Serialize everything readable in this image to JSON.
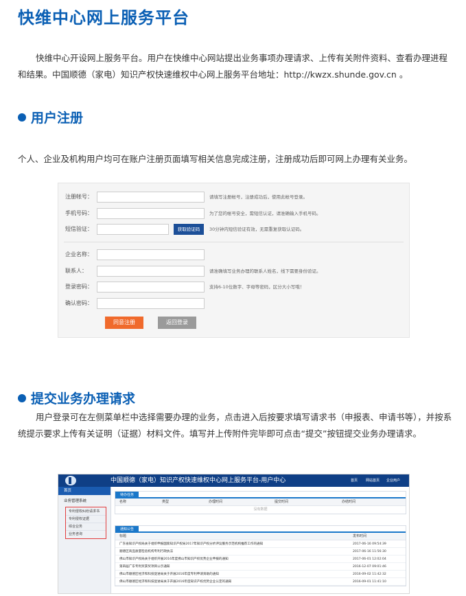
{
  "page": {
    "title": "快维中心网上服务平台",
    "intro": "快维中心开设网上服务平台。用户在快维中心网站提出业务事项办理请求、上传有关附件资料、查看办理进程和结果。中国顺德（家电）知识产权快速维权中心网上服务平台地址：http://kwzx.shunde.gov.cn 。"
  },
  "section1": {
    "title": "用户注册",
    "text": "个人、企业及机构用户均可在账户注册页面填写相关信息完成注册，注册成功后即可网上办理有关业务。"
  },
  "reg_form": {
    "fields": [
      {
        "label": "注册帐号：",
        "hint": "请填写注册帐号，注册成功后，使用此帐号登录。"
      },
      {
        "label": "手机号码：",
        "hint": "为了您的帐号安全，需短信认证，请准确输入手机号码。"
      },
      {
        "label": "短信验证：",
        "hint": "30分钟内短信验证有效，无需重复获取认证码。"
      },
      {
        "label": "企业名称：",
        "hint": ""
      },
      {
        "label": "联系人：",
        "hint": "请准确填写业务办理的联系人姓名，线下需要身份验证。"
      },
      {
        "label": "登录密码：",
        "hint": "支持6-10位数字、字母等密码，区分大小写哦！"
      },
      {
        "label": "确认密码：",
        "hint": ""
      }
    ],
    "sms_button": "获取验证码",
    "submit_button": "同意注册",
    "back_button": "返回登录"
  },
  "section2": {
    "title": "提交业务办理请求",
    "text": "用户登录可在左侧菜单栏中选择需要办理的业务，点击进入后按要求填写请求书（申报表、申请书等），并按系统提示要求上传有关证明（证据）材料文件。填写并上传附件完毕即可点击“提交”按钮提交业务办理请求。"
  },
  "user_center": {
    "title": "中国顺德（家电）知识产权快速维权中心网上服务平台-用户中心",
    "top_links": [
      "首页",
      "网站首页",
      "企业用户"
    ],
    "home": "首页",
    "menu_group": "业务管理系统",
    "menu_items": [
      "专利侵权纠纷请求书",
      "专利侵权证据",
      "综合业务",
      "业务咨询"
    ],
    "task_tab": "待办任务",
    "task_headers": [
      "名称",
      "类型",
      "办理时间",
      "提交时间",
      "办结时间"
    ],
    "task_empty": "没有数据",
    "notice_tab": "通知公告",
    "notice_headers": [
      "标题",
      "发布时间"
    ],
    "notices": [
      {
        "title": "广东省知识产权局关于组织申报国家知识产权局2017年知识产权分析评议服务示范机构推荐工作的通知",
        "date": "2017-06-16 09:54:39"
      },
      {
        "title": "顺德区商品质量检验机构专利行政执法",
        "date": "2017-06-16 11:56:30"
      },
      {
        "title": "佛山市知识产权局关于组织开展2016年度佛山市知识产权优势企业申报的通知",
        "date": "2017-06-01 12:02:04"
      },
      {
        "title": "第四届广东专利奖获奖项目公示通知",
        "date": "2016-12-07 09:01:46"
      },
      {
        "title": "佛山市顺德区经济和科技促进局关于开展2016年度专利申请资助的通知",
        "date": "2016-09-02 11:42:32"
      },
      {
        "title": "佛山市顺德区经济和科技促进局关于开展2016年度知识产权优势企业认定的通知",
        "date": "2016-09-01 11:41:10"
      }
    ]
  }
}
